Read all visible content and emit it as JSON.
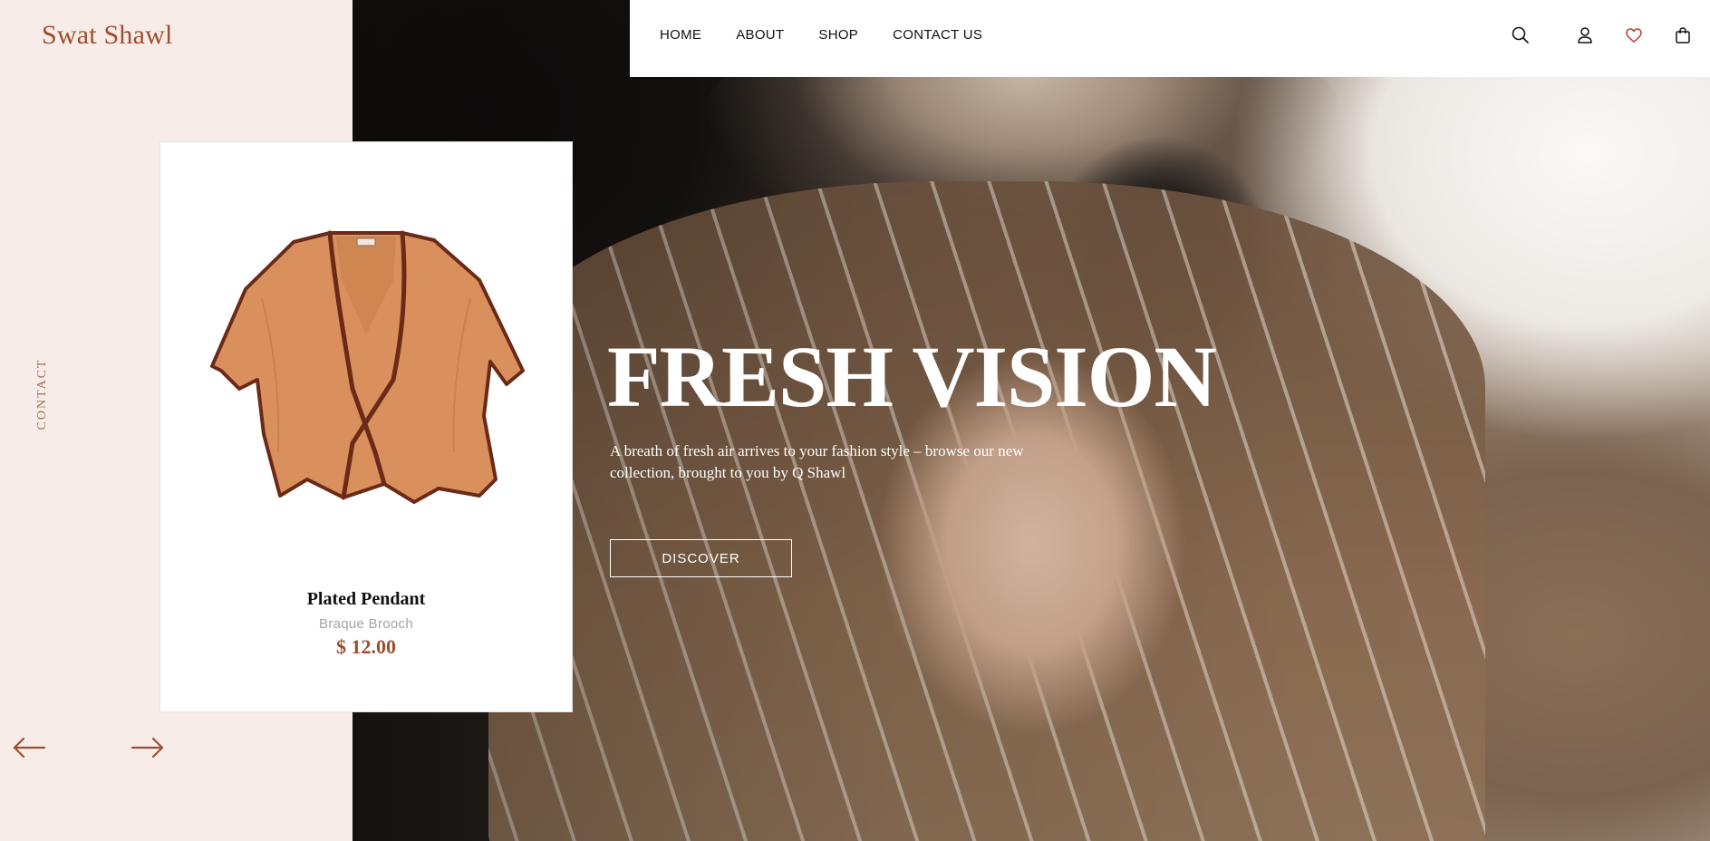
{
  "brand": {
    "logo": "Swat Shawl",
    "accent_color": "#9c4f2e"
  },
  "header": {
    "nav": [
      {
        "label": "HOME"
      },
      {
        "label": "ABOUT"
      },
      {
        "label": "SHOP"
      },
      {
        "label": "CONTACT US"
      }
    ],
    "icons": [
      "search-icon",
      "user-icon",
      "heart-icon",
      "bag-icon"
    ]
  },
  "sidebar": {
    "vertical_label": "CONTACT",
    "prev_icon": "arrow-left-icon",
    "next_icon": "arrow-right-icon"
  },
  "product_card": {
    "name": "Plated Pendant",
    "subtitle": "Braque Brooch",
    "price": "$ 12.00",
    "image_icon": "shawl-cape-image"
  },
  "hero": {
    "title": "FRESH VISION",
    "subtitle": "A breath of fresh air arrives to your fashion style – browse our new collection, brought to you by Q Shawl",
    "cta_label": "DISCOVER"
  }
}
